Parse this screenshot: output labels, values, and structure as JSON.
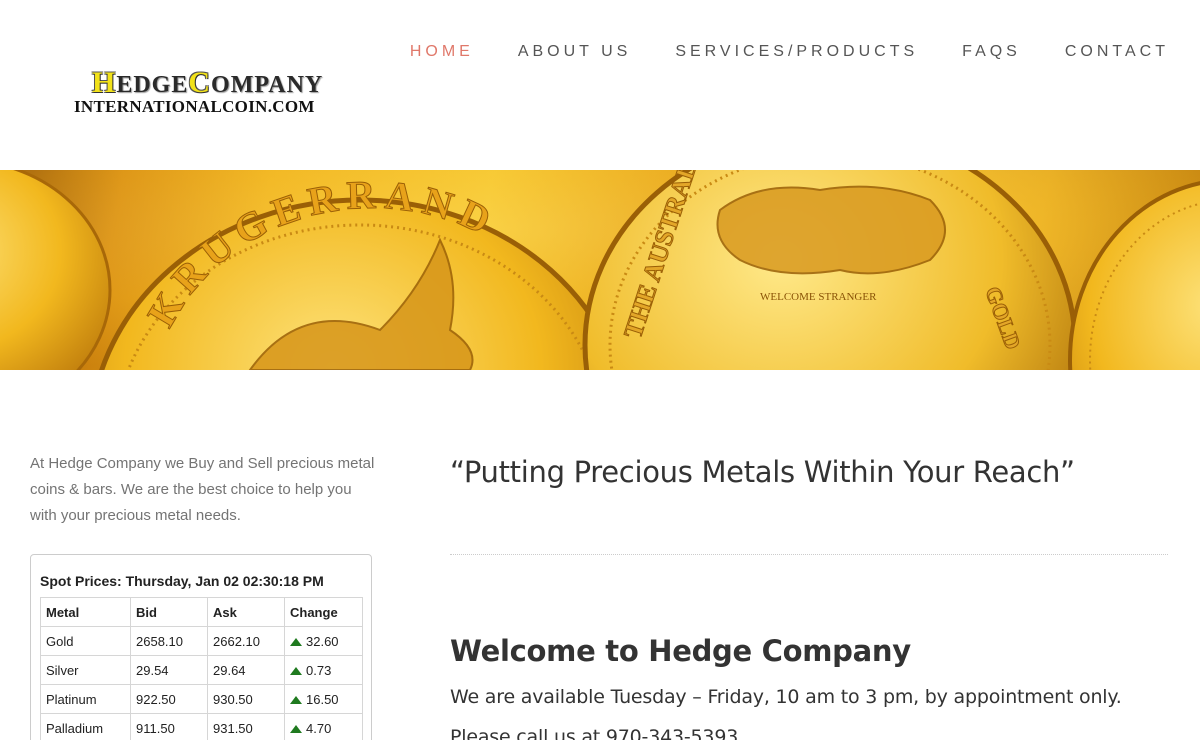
{
  "logo": {
    "line1_cap1": "H",
    "line1_rest1": "EDGE",
    "line1_cap2": "C",
    "line1_rest2": "OMPANY",
    "line2": "INTERNATIONALCOIN.COM"
  },
  "nav": {
    "items": [
      {
        "label": "HOME",
        "active": true
      },
      {
        "label": "ABOUT US",
        "active": false
      },
      {
        "label": "SERVICES/PRODUCTS",
        "active": false
      },
      {
        "label": "FAQS",
        "active": false
      },
      {
        "label": "CONTACT",
        "active": false
      }
    ]
  },
  "banner": {
    "coin1_text": "KRUGERRAND",
    "coin2_text": "THE AUSTRALIAN",
    "coin2_sub": "GOLD"
  },
  "intro": "At Hedge Company we Buy and Sell precious metal coins & bars. We are the best choice to help you with your precious metal needs.",
  "spot_prices": {
    "title": "Spot Prices: Thursday, Jan 02 02:30:18 PM",
    "headers": [
      "Metal",
      "Bid",
      "Ask",
      "Change"
    ],
    "rows": [
      {
        "metal": "Gold",
        "bid": "2658.10",
        "ask": "2662.10",
        "change": "32.60"
      },
      {
        "metal": "Silver",
        "bid": "29.54",
        "ask": "29.64",
        "change": "0.73"
      },
      {
        "metal": "Platinum",
        "bid": "922.50",
        "ask": "930.50",
        "change": "16.50"
      },
      {
        "metal": "Palladium",
        "bid": "911.50",
        "ask": "931.50",
        "change": "4.70"
      }
    ]
  },
  "main": {
    "tagline": "“Putting Precious Metals Within Your Reach”",
    "welcome": "Welcome to Hedge Company",
    "availability": "We are available Tuesday – Friday, 10 am to 3 pm, by appointment only.",
    "call": "Please call us at 970-343-5393"
  },
  "colors": {
    "nav_active": "#e0786a",
    "nav_default": "#555555",
    "change_up": "#1f7a1f",
    "gold": "#f2b41c"
  }
}
